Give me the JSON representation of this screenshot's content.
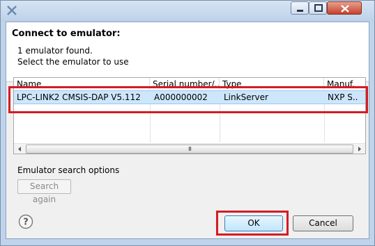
{
  "dialog": {
    "heading": "Connect to emulator:",
    "info_line1": "1 emulator found.",
    "info_line2": "Select the emulator to use"
  },
  "table": {
    "columns": [
      "Name",
      "Serial number/...",
      "Type",
      "Manuf."
    ],
    "rows": [
      {
        "name": "LPC-LINK2 CMSIS-DAP V5.112",
        "serial": "A000000002",
        "type": "LinkServer",
        "manufacturer": "NXP S..",
        "selected": true
      }
    ],
    "scroll_thumb_glyph": "III"
  },
  "search_options": {
    "group_label": "Emulator search options",
    "search_button_label": "Search again",
    "search_button_enabled": false
  },
  "buttons": {
    "help_glyph": "?",
    "ok_label": "OK",
    "cancel_label": "Cancel"
  },
  "icons": {
    "app": "eclipse-x-icon",
    "minimize": "minimize-icon",
    "maximize": "maximize-icon",
    "close": "close-icon",
    "help": "help-icon"
  },
  "colors": {
    "highlight_border": "#d51b24",
    "selection": "#cde6fb",
    "title_bar": "#bfd3ea"
  }
}
